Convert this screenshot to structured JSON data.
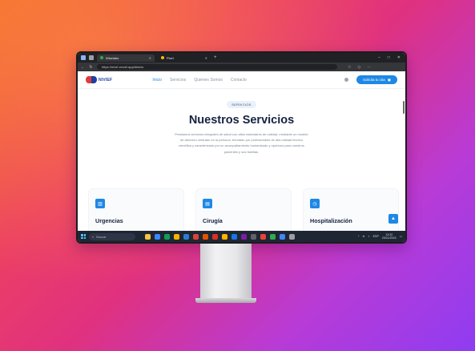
{
  "browser": {
    "tab_active_title": "Wiselabs",
    "tab_inactive_title": "Pixel",
    "url": "https://nivel.vercel.app/#inicio"
  },
  "site": {
    "logo_text": "NIVIEF",
    "nav": [
      "Inicio",
      "Servicios",
      "Quienes Somos",
      "Contacto"
    ],
    "cta_label": "Solicita tu cita"
  },
  "hero": {
    "badge": "SERVICIOS",
    "title": "Nuestros Servicios",
    "description": "Prestamos servicios integrales de salud con altos estándares de calidad, mediante un modelo de atención centrado en la persona, brindado por profesionales de alta calidad técnico científica y caracterizado por un acompañamiento humanizado y oportuno para nuestros pacientes y sus familias."
  },
  "cards": [
    {
      "title": "Urgencias",
      "icon": "chart-icon"
    },
    {
      "title": "Cirugía",
      "icon": "calendar-icon"
    },
    {
      "title": "Hospitalización",
      "icon": "clock-icon"
    }
  ],
  "taskbar": {
    "search_placeholder": "Buscar",
    "time": "13:32",
    "date": "20/11/2024",
    "lang": "ESP"
  },
  "colors": {
    "accent": "#1e88e5",
    "heading": "#152240",
    "logo_red": "#e03b3b",
    "logo_blue": "#1e3fa0"
  }
}
